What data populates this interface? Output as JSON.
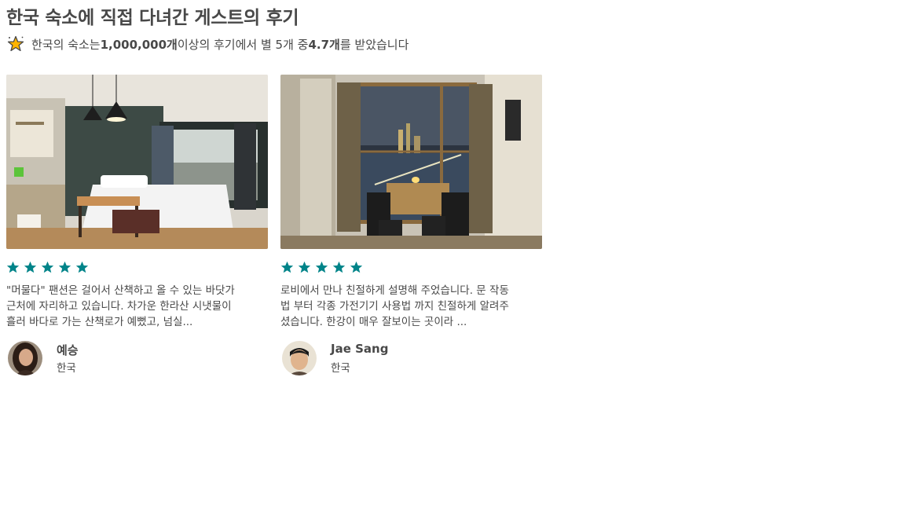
{
  "header": {
    "title": "한국 숙소에 직접 다녀간 게스트의 후기",
    "summary_prefix": "한국의 숙소는 ",
    "review_count": "1,000,000개",
    "summary_middle": " 이상의 후기에서 별 5개 중 ",
    "average_rating": "4.7개",
    "summary_suffix": "를 받았습니다",
    "icon": "star-badge-icon"
  },
  "colors": {
    "rating_star": "#008489",
    "text": "#484848",
    "badge_star": "#FFB400"
  },
  "reviews": [
    {
      "rating": 5,
      "text": "\"머물다\" 팬션은 걸어서 산책하고 올 수 있는 바닷가 근처에 자리하고 있습니다. 차가운 한라산 시냇물이 흘러 바다로 가는 산책로가 예뻤고, 넘실...",
      "author": "예승",
      "location": "한국",
      "image": "studio-bedroom-photo"
    },
    {
      "rating": 5,
      "text": "로비에서 만나 친절하게 설명해 주었습니다. 문 작동법 부터 각종 가전기기 사용법 까지 친절하게 알려주셨습니다. 한강이 매우 잘보이는 곳이라 ...",
      "author": "Jae Sang",
      "location": "한국",
      "image": "river-view-dining-photo"
    }
  ]
}
